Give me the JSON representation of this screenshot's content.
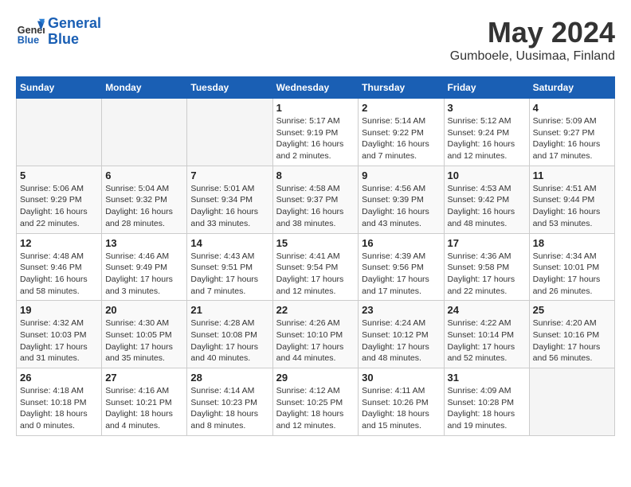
{
  "header": {
    "logo_line1": "General",
    "logo_line2": "Blue",
    "month": "May 2024",
    "location": "Gumboele, Uusimaa, Finland"
  },
  "days_of_week": [
    "Sunday",
    "Monday",
    "Tuesday",
    "Wednesday",
    "Thursday",
    "Friday",
    "Saturday"
  ],
  "weeks": [
    [
      {
        "day": "",
        "info": ""
      },
      {
        "day": "",
        "info": ""
      },
      {
        "day": "",
        "info": ""
      },
      {
        "day": "1",
        "info": "Sunrise: 5:17 AM\nSunset: 9:19 PM\nDaylight: 16 hours\nand 2 minutes."
      },
      {
        "day": "2",
        "info": "Sunrise: 5:14 AM\nSunset: 9:22 PM\nDaylight: 16 hours\nand 7 minutes."
      },
      {
        "day": "3",
        "info": "Sunrise: 5:12 AM\nSunset: 9:24 PM\nDaylight: 16 hours\nand 12 minutes."
      },
      {
        "day": "4",
        "info": "Sunrise: 5:09 AM\nSunset: 9:27 PM\nDaylight: 16 hours\nand 17 minutes."
      }
    ],
    [
      {
        "day": "5",
        "info": "Sunrise: 5:06 AM\nSunset: 9:29 PM\nDaylight: 16 hours\nand 22 minutes."
      },
      {
        "day": "6",
        "info": "Sunrise: 5:04 AM\nSunset: 9:32 PM\nDaylight: 16 hours\nand 28 minutes."
      },
      {
        "day": "7",
        "info": "Sunrise: 5:01 AM\nSunset: 9:34 PM\nDaylight: 16 hours\nand 33 minutes."
      },
      {
        "day": "8",
        "info": "Sunrise: 4:58 AM\nSunset: 9:37 PM\nDaylight: 16 hours\nand 38 minutes."
      },
      {
        "day": "9",
        "info": "Sunrise: 4:56 AM\nSunset: 9:39 PM\nDaylight: 16 hours\nand 43 minutes."
      },
      {
        "day": "10",
        "info": "Sunrise: 4:53 AM\nSunset: 9:42 PM\nDaylight: 16 hours\nand 48 minutes."
      },
      {
        "day": "11",
        "info": "Sunrise: 4:51 AM\nSunset: 9:44 PM\nDaylight: 16 hours\nand 53 minutes."
      }
    ],
    [
      {
        "day": "12",
        "info": "Sunrise: 4:48 AM\nSunset: 9:46 PM\nDaylight: 16 hours\nand 58 minutes."
      },
      {
        "day": "13",
        "info": "Sunrise: 4:46 AM\nSunset: 9:49 PM\nDaylight: 17 hours\nand 3 minutes."
      },
      {
        "day": "14",
        "info": "Sunrise: 4:43 AM\nSunset: 9:51 PM\nDaylight: 17 hours\nand 7 minutes."
      },
      {
        "day": "15",
        "info": "Sunrise: 4:41 AM\nSunset: 9:54 PM\nDaylight: 17 hours\nand 12 minutes."
      },
      {
        "day": "16",
        "info": "Sunrise: 4:39 AM\nSunset: 9:56 PM\nDaylight: 17 hours\nand 17 minutes."
      },
      {
        "day": "17",
        "info": "Sunrise: 4:36 AM\nSunset: 9:58 PM\nDaylight: 17 hours\nand 22 minutes."
      },
      {
        "day": "18",
        "info": "Sunrise: 4:34 AM\nSunset: 10:01 PM\nDaylight: 17 hours\nand 26 minutes."
      }
    ],
    [
      {
        "day": "19",
        "info": "Sunrise: 4:32 AM\nSunset: 10:03 PM\nDaylight: 17 hours\nand 31 minutes."
      },
      {
        "day": "20",
        "info": "Sunrise: 4:30 AM\nSunset: 10:05 PM\nDaylight: 17 hours\nand 35 minutes."
      },
      {
        "day": "21",
        "info": "Sunrise: 4:28 AM\nSunset: 10:08 PM\nDaylight: 17 hours\nand 40 minutes."
      },
      {
        "day": "22",
        "info": "Sunrise: 4:26 AM\nSunset: 10:10 PM\nDaylight: 17 hours\nand 44 minutes."
      },
      {
        "day": "23",
        "info": "Sunrise: 4:24 AM\nSunset: 10:12 PM\nDaylight: 17 hours\nand 48 minutes."
      },
      {
        "day": "24",
        "info": "Sunrise: 4:22 AM\nSunset: 10:14 PM\nDaylight: 17 hours\nand 52 minutes."
      },
      {
        "day": "25",
        "info": "Sunrise: 4:20 AM\nSunset: 10:16 PM\nDaylight: 17 hours\nand 56 minutes."
      }
    ],
    [
      {
        "day": "26",
        "info": "Sunrise: 4:18 AM\nSunset: 10:18 PM\nDaylight: 18 hours\nand 0 minutes."
      },
      {
        "day": "27",
        "info": "Sunrise: 4:16 AM\nSunset: 10:21 PM\nDaylight: 18 hours\nand 4 minutes."
      },
      {
        "day": "28",
        "info": "Sunrise: 4:14 AM\nSunset: 10:23 PM\nDaylight: 18 hours\nand 8 minutes."
      },
      {
        "day": "29",
        "info": "Sunrise: 4:12 AM\nSunset: 10:25 PM\nDaylight: 18 hours\nand 12 minutes."
      },
      {
        "day": "30",
        "info": "Sunrise: 4:11 AM\nSunset: 10:26 PM\nDaylight: 18 hours\nand 15 minutes."
      },
      {
        "day": "31",
        "info": "Sunrise: 4:09 AM\nSunset: 10:28 PM\nDaylight: 18 hours\nand 19 minutes."
      },
      {
        "day": "",
        "info": ""
      }
    ]
  ]
}
